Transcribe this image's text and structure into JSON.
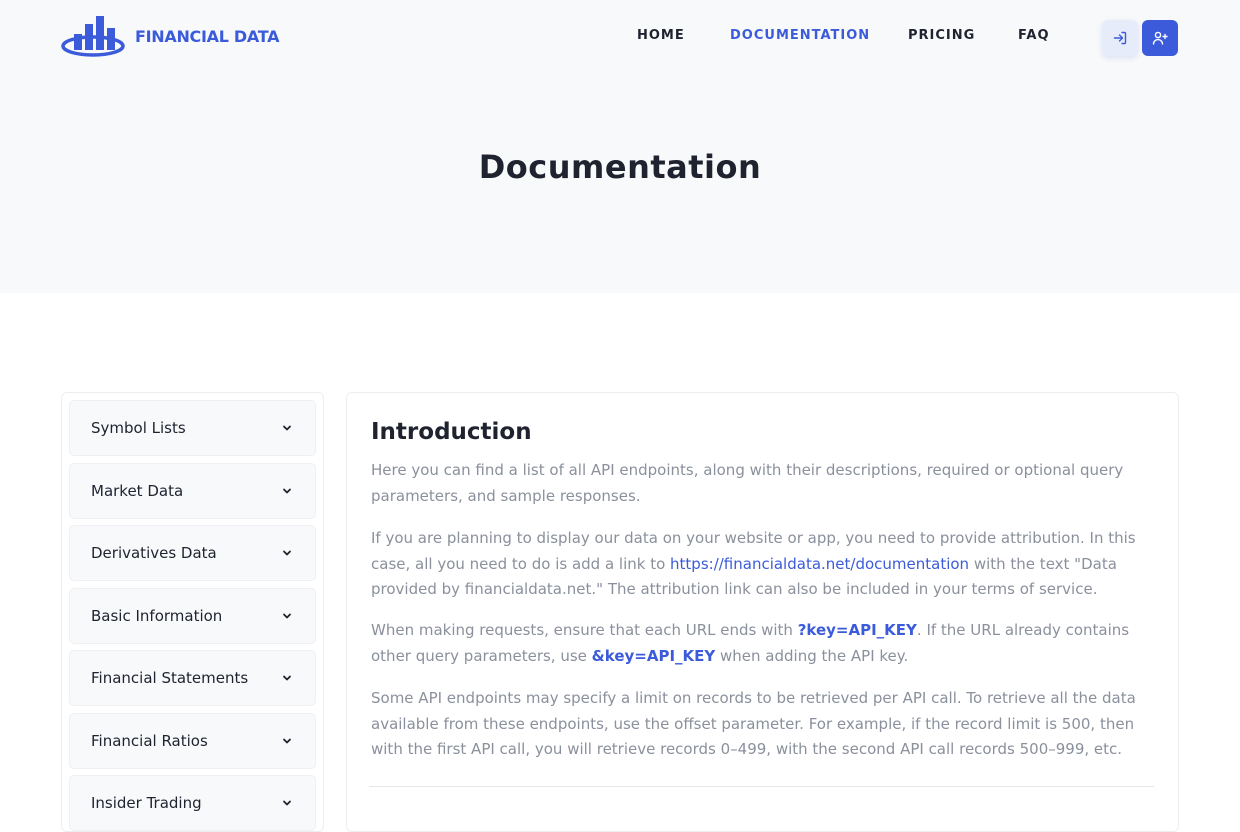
{
  "brand": {
    "name": "FINANCIAL DATA",
    "color": "#3b5bdb"
  },
  "nav": {
    "items": [
      {
        "label": "HOME"
      },
      {
        "label": "DOCUMENTATION",
        "active": true
      },
      {
        "label": "PRICING"
      },
      {
        "label": "FAQ"
      }
    ],
    "login_icon": "login-icon",
    "signup_icon": "user-plus-icon"
  },
  "page": {
    "title": "Documentation"
  },
  "sidebar": {
    "items": [
      {
        "label": "Symbol Lists"
      },
      {
        "label": "Market Data"
      },
      {
        "label": "Derivatives Data"
      },
      {
        "label": "Basic Information"
      },
      {
        "label": "Financial Statements"
      },
      {
        "label": "Financial Ratios"
      },
      {
        "label": "Insider Trading"
      }
    ],
    "chevron_icon": "chevron-down-icon"
  },
  "intro": {
    "title": "Introduction",
    "p1": "Here you can find a list of all API endpoints, along with their descriptions, required or optional query parameters, and sample responses.",
    "p2_a": "If you are planning to display our data on your website or app, you need to provide attribution. In this case, all you need to do is add a link to ",
    "p2_link": "https://financialdata.net/documentation",
    "p2_b": " with the text \"Data provided by financialdata.net.\" The attribution link can also be included in your terms of service.",
    "p3_a": "When making requests, ensure that each URL ends with ",
    "p3_code1": "?key=API_KEY",
    "p3_b": ". If the URL already contains other query parameters, use ",
    "p3_code2": "&key=API_KEY",
    "p3_c": " when adding the API key.",
    "p4": "Some API endpoints may specify a limit on records to be retrieved per API call. To retrieve all the data available from these endpoints, use the offset parameter. For example, if the record limit is 500, then with the first API call, you will retrieve records 0–499, with the second API call records 500–999, etc."
  }
}
